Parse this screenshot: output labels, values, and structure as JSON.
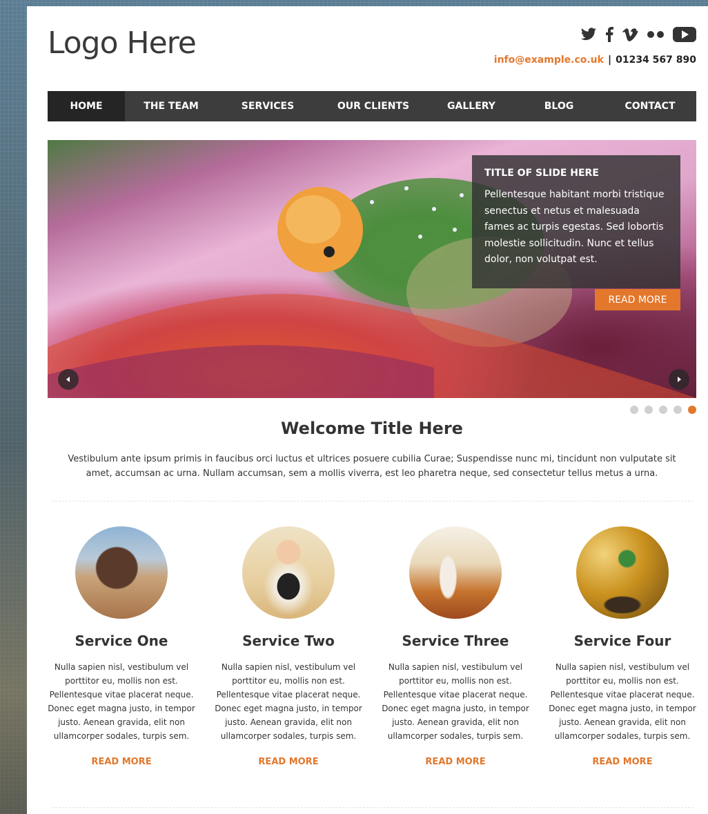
{
  "header": {
    "logo": "Logo Here",
    "email": "info@example.co.uk",
    "separator": "|",
    "phone": "01234 567 890",
    "social_icons": [
      "twitter-icon",
      "facebook-icon",
      "vimeo-icon",
      "flickr-icon",
      "youtube-icon"
    ]
  },
  "nav": {
    "items": [
      {
        "label": "HOME",
        "active": true
      },
      {
        "label": "THE TEAM",
        "active": false
      },
      {
        "label": "SERVICES",
        "active": false
      },
      {
        "label": "OUR CLIENTS",
        "active": false
      },
      {
        "label": "GALLERY",
        "active": false
      },
      {
        "label": "BLOG",
        "active": false
      },
      {
        "label": "CONTACT",
        "active": false
      }
    ]
  },
  "slider": {
    "caption_title": "TITLE OF SLIDE HERE",
    "caption_text": "Pellentesque habitant morbi tristique senectus et netus et malesuada fames ac turpis egestas. Sed lobortis molestie sollicitudin. Nunc et tellus dolor, non volutpat est.",
    "button_label": "READ MORE",
    "dot_count": 5,
    "active_dot": 5
  },
  "welcome": {
    "title": "Welcome Title Here",
    "text": "Vestibulum ante ipsum primis in faucibus orci luctus et ultrices posuere cubilia Curae; Suspendisse nunc mi, tincidunt non vulputate sit amet, accumsan ac urna. Nullam accumsan, sem a mollis viverra, est leo pharetra neque, sed consectetur tellus metus a urna."
  },
  "services": [
    {
      "title": "Service One",
      "text": "Nulla sapien nisl, vestibulum vel porttitor eu, mollis non est. Pellentesque vitae placerat neque. Donec eget magna justo, in tempor justo. Aenean gravida, elit non ullamcorper sodales, turpis sem.",
      "link": "READ MORE"
    },
    {
      "title": "Service Two",
      "text": "Nulla sapien nisl, vestibulum vel porttitor eu, mollis non est. Pellentesque vitae placerat neque. Donec eget magna justo, in tempor justo. Aenean gravida, elit non ullamcorper sodales, turpis sem.",
      "link": "READ MORE"
    },
    {
      "title": "Service Three",
      "text": "Nulla sapien nisl, vestibulum vel porttitor eu, mollis non est. Pellentesque vitae placerat neque. Donec eget magna justo, in tempor justo. Aenean gravida, elit non ullamcorper sodales, turpis sem.",
      "link": "READ MORE"
    },
    {
      "title": "Service Four",
      "text": "Nulla sapien nisl, vestibulum vel porttitor eu, mollis non est. Pellentesque vitae placerat neque. Donec eget magna justo, in tempor justo. Aenean gravida, elit non ullamcorper sodales, turpis sem.",
      "link": "READ MORE"
    }
  ],
  "colors": {
    "accent": "#e3772b",
    "nav_bg": "#3d3d3e",
    "nav_active_bg": "#252525",
    "text": "#333333"
  }
}
